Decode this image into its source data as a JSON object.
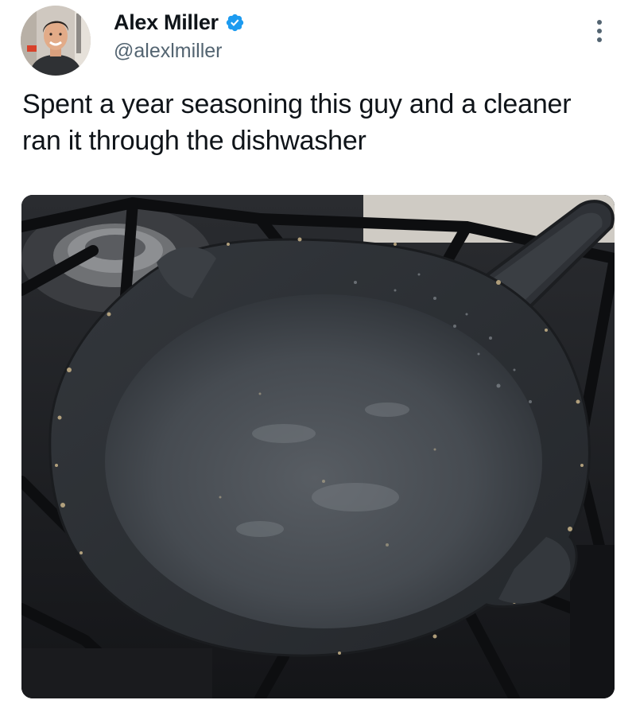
{
  "tweet": {
    "author": {
      "display_name": "Alex Miller",
      "handle": "@alexlmiller",
      "verified": true,
      "avatar_icon": "person-avatar"
    },
    "text": "Spent a year seasoning this guy and a cleaner ran it through the dishwasher",
    "media": {
      "type": "photo",
      "icon": "cast-iron-skillet-photo"
    },
    "more_icon": "more-vertical-icon"
  },
  "colors": {
    "verified_badge": "#1d9bf0",
    "handle": "#536471",
    "text": "#0f1419"
  }
}
